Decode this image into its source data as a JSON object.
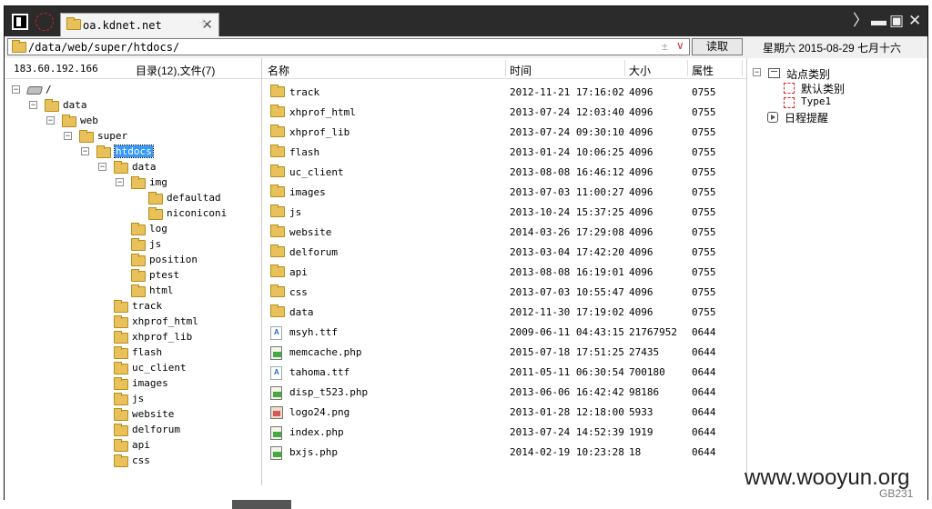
{
  "window": {
    "tab_title": "oa.kdnet.net",
    "new_tab_symbol": "+",
    "tab_close_symbol": "✕",
    "chevron_symbol": "〉",
    "min_symbol": "▬",
    "max_symbol": "▣",
    "close_symbol": "✕"
  },
  "address": {
    "path": "/data/web/super/htdocs/",
    "pm_symbol": "±",
    "dropdown_symbol": "∨",
    "read_button": "读取",
    "date": "星期六 2015-08-29 七月十六"
  },
  "tree_header": {
    "ip": "183.60.192.166",
    "counts": "目录(12),文件(7)"
  },
  "columns": {
    "name": "名称",
    "time": "时间",
    "size": "大小",
    "attr": "属性"
  },
  "tree": [
    {
      "label": "/",
      "toggle": "−",
      "icon": "drive"
    },
    {
      "label": "data",
      "toggle": "−",
      "icon": "folder"
    },
    {
      "label": "web",
      "toggle": "−",
      "icon": "folder"
    },
    {
      "label": "super",
      "toggle": "−",
      "icon": "folder"
    },
    {
      "label": "htdocs",
      "toggle": "−",
      "icon": "folder",
      "selected": true
    },
    {
      "label": "data",
      "toggle": "−",
      "icon": "folder"
    },
    {
      "label": "img",
      "toggle": "−",
      "icon": "folder"
    },
    {
      "label": "defaultad",
      "toggle": "",
      "icon": "folder"
    },
    {
      "label": "niconiconi",
      "toggle": "",
      "icon": "folder"
    },
    {
      "label": "log",
      "toggle": "",
      "icon": "folder"
    },
    {
      "label": "js",
      "toggle": "",
      "icon": "folder"
    },
    {
      "label": "position",
      "toggle": "",
      "icon": "folder"
    },
    {
      "label": "ptest",
      "toggle": "",
      "icon": "folder"
    },
    {
      "label": "html",
      "toggle": "",
      "icon": "folder"
    },
    {
      "label": "track",
      "toggle": "",
      "icon": "folder"
    },
    {
      "label": "xhprof_html",
      "toggle": "",
      "icon": "folder"
    },
    {
      "label": "xhprof_lib",
      "toggle": "",
      "icon": "folder"
    },
    {
      "label": "flash",
      "toggle": "",
      "icon": "folder"
    },
    {
      "label": "uc_client",
      "toggle": "",
      "icon": "folder"
    },
    {
      "label": "images",
      "toggle": "",
      "icon": "folder"
    },
    {
      "label": "js",
      "toggle": "",
      "icon": "folder"
    },
    {
      "label": "website",
      "toggle": "",
      "icon": "folder"
    },
    {
      "label": "delforum",
      "toggle": "",
      "icon": "folder"
    },
    {
      "label": "api",
      "toggle": "",
      "icon": "folder"
    },
    {
      "label": "css",
      "toggle": "",
      "icon": "folder"
    }
  ],
  "files": [
    {
      "name": "track",
      "time": "2012-11-21 17:16:02",
      "size": "4096",
      "attr": "0755",
      "icon": "folder"
    },
    {
      "name": "xhprof_html",
      "time": "2013-07-24 12:03:40",
      "size": "4096",
      "attr": "0755",
      "icon": "folder"
    },
    {
      "name": "xhprof_lib",
      "time": "2013-07-24 09:30:10",
      "size": "4096",
      "attr": "0755",
      "icon": "folder"
    },
    {
      "name": "flash",
      "time": "2013-01-24 10:06:25",
      "size": "4096",
      "attr": "0755",
      "icon": "folder"
    },
    {
      "name": "uc_client",
      "time": "2013-08-08 16:46:12",
      "size": "4096",
      "attr": "0755",
      "icon": "folder"
    },
    {
      "name": "images",
      "time": "2013-07-03 11:00:27",
      "size": "4096",
      "attr": "0755",
      "icon": "folder"
    },
    {
      "name": "js",
      "time": "2013-10-24 15:37:25",
      "size": "4096",
      "attr": "0755",
      "icon": "folder"
    },
    {
      "name": "website",
      "time": "2014-03-26 17:29:08",
      "size": "4096",
      "attr": "0755",
      "icon": "folder"
    },
    {
      "name": "delforum",
      "time": "2013-03-04 17:42:20",
      "size": "4096",
      "attr": "0755",
      "icon": "folder"
    },
    {
      "name": "api",
      "time": "2013-08-08 16:19:01",
      "size": "4096",
      "attr": "0755",
      "icon": "folder"
    },
    {
      "name": "css",
      "time": "2013-07-03 10:55:47",
      "size": "4096",
      "attr": "0755",
      "icon": "folder"
    },
    {
      "name": "data",
      "time": "2012-11-30 17:19:02",
      "size": "4096",
      "attr": "0755",
      "icon": "folder"
    },
    {
      "name": "msyh.ttf",
      "time": "2009-06-11 04:43:15",
      "size": "21767952",
      "attr": "0644",
      "icon": "ttf"
    },
    {
      "name": "memcache.php",
      "time": "2015-07-18 17:51:25",
      "size": "27435",
      "attr": "0644",
      "icon": "php"
    },
    {
      "name": "tahoma.ttf",
      "time": "2011-05-11 06:30:54",
      "size": "700180",
      "attr": "0644",
      "icon": "ttf"
    },
    {
      "name": "disp_t523.php",
      "time": "2013-06-06 16:42:42",
      "size": "98186",
      "attr": "0644",
      "icon": "php"
    },
    {
      "name": "logo24.png",
      "time": "2013-01-28 12:18:00",
      "size": "5933",
      "attr": "0644",
      "icon": "png"
    },
    {
      "name": "index.php",
      "time": "2013-07-24 14:52:39",
      "size": "1919",
      "attr": "0644",
      "icon": "php"
    },
    {
      "name": "bxjs.php",
      "time": "2014-02-19 10:23:28",
      "size": "18",
      "attr": "0644",
      "icon": "php"
    }
  ],
  "right_panel": {
    "root_toggle": "−",
    "site_category": "站点类别",
    "default_category": "默认类别",
    "type1": "Type1",
    "schedule": "日程提醒"
  },
  "watermark": "www.wooyun.org",
  "gb_text": "GB231"
}
